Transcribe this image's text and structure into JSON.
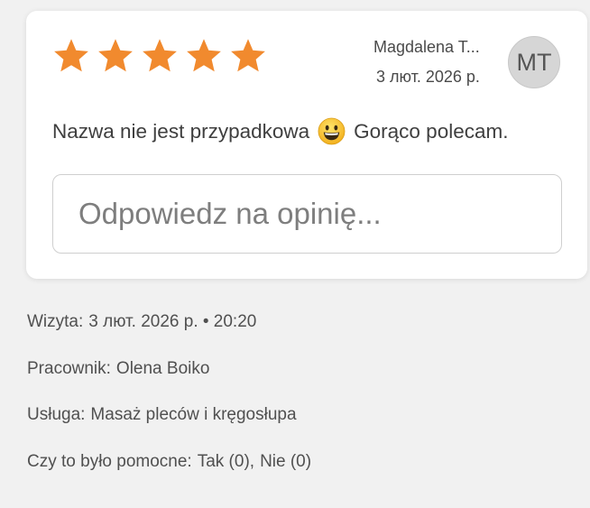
{
  "review": {
    "rating": 5,
    "rating_max": 5,
    "star_color": "#f18a2e",
    "author": "Magdalena T...",
    "date": "3 лют. 2026 р.",
    "avatar_initials": "MT",
    "text_before_emoji": "Nazwa nie jest przypadkowa",
    "emoji": "grinning-face-emoji",
    "text_after_emoji": "Gorąco polecam.",
    "reply_placeholder": "Odpowiedz na opinię..."
  },
  "details": {
    "visit_label": "Wizyta:",
    "visit_value": "3 лют. 2026 р. • 20:20",
    "employee_label": "Pracownik:",
    "employee_value": "Olena Boiko",
    "service_label": "Usługa:",
    "service_value": "Masaż pleców i kręgosłupa",
    "helpful_label": "Czy to było pomocne:",
    "helpful_yes": "Tak (0)",
    "helpful_sep": ",",
    "helpful_no": "Nie (0)"
  }
}
